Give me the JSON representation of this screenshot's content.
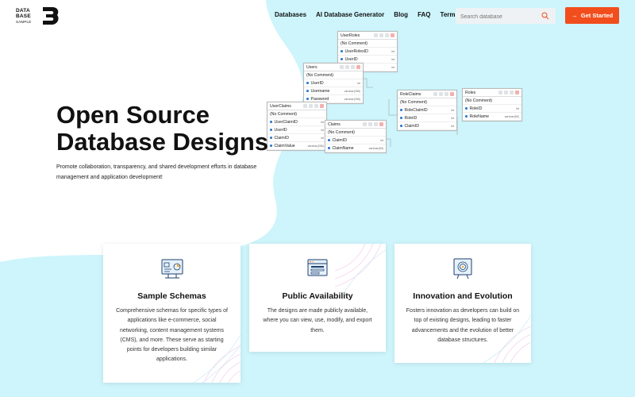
{
  "logo": {
    "line1": "DATA",
    "line2": "BASE",
    "line3": "SAMPLE"
  },
  "nav": {
    "items": [
      {
        "label": "Databases"
      },
      {
        "label": "AI Database Generator"
      },
      {
        "label": "Blog"
      },
      {
        "label": "FAQ"
      },
      {
        "label": "Terms"
      }
    ]
  },
  "search": {
    "placeholder": "Search database"
  },
  "cta": {
    "label": "Get Started"
  },
  "hero": {
    "title_line1": "Open Source",
    "title_line2": "Database Designs",
    "subtitle": "Promote collaboration, transparency, and shared development efforts in database management and application development!"
  },
  "er_diagram": {
    "tables": [
      {
        "name": "UserRoles",
        "comment": "(No Comment)",
        "fields": [
          {
            "name": "UserRolesID",
            "type": "int"
          },
          {
            "name": "UserID",
            "type": "int"
          },
          {
            "name": "RoleID",
            "type": "int"
          }
        ]
      },
      {
        "name": "Users",
        "comment": "(No Comment)",
        "fields": [
          {
            "name": "UserID",
            "type": "int"
          },
          {
            "name": "Username",
            "type": "varchar(255)"
          },
          {
            "name": "Password",
            "type": "varchar(255)"
          }
        ]
      },
      {
        "name": "UserClaims",
        "comment": "(No Comment)",
        "fields": [
          {
            "name": "UserClaimID",
            "type": "int"
          },
          {
            "name": "UserID",
            "type": "int"
          },
          {
            "name": "ClaimID",
            "type": "int"
          },
          {
            "name": "ClaimValue",
            "type": "varchar(255)"
          }
        ]
      },
      {
        "name": "Claims",
        "comment": "(No Comment)",
        "fields": [
          {
            "name": "ClaimID",
            "type": "int"
          },
          {
            "name": "ClaimName",
            "type": "varchar(50)"
          }
        ]
      },
      {
        "name": "RoleClaims",
        "comment": "(No Comment)",
        "fields": [
          {
            "name": "RoleClaimID",
            "type": "int"
          },
          {
            "name": "RoleID",
            "type": "int"
          },
          {
            "name": "ClaimID",
            "type": "int"
          }
        ]
      },
      {
        "name": "Roles",
        "comment": "(No Comment)",
        "fields": [
          {
            "name": "RoleID",
            "type": "int"
          },
          {
            "name": "RoleName",
            "type": "varchar(50)"
          }
        ]
      }
    ]
  },
  "cards": [
    {
      "title": "Sample Schemas",
      "body": "Comprehensive schemas for specific types of applications like e-commerce, social networking, content management systems (CMS), and more. These serve as starting points for developers building similar applications."
    },
    {
      "title": "Public Availability",
      "body": "The designs are made publicly available, where you can view, use, modify, and export them."
    },
    {
      "title": "Innovation and Evolution",
      "body": "Fosters innovation as developers can build on top of existing designs, leading to faster advancements and the evolution of better database structures."
    }
  ],
  "colors": {
    "accent": "#f24d1c",
    "blob": "#cdf5fb",
    "icon_blue": "#1c3f6e"
  }
}
